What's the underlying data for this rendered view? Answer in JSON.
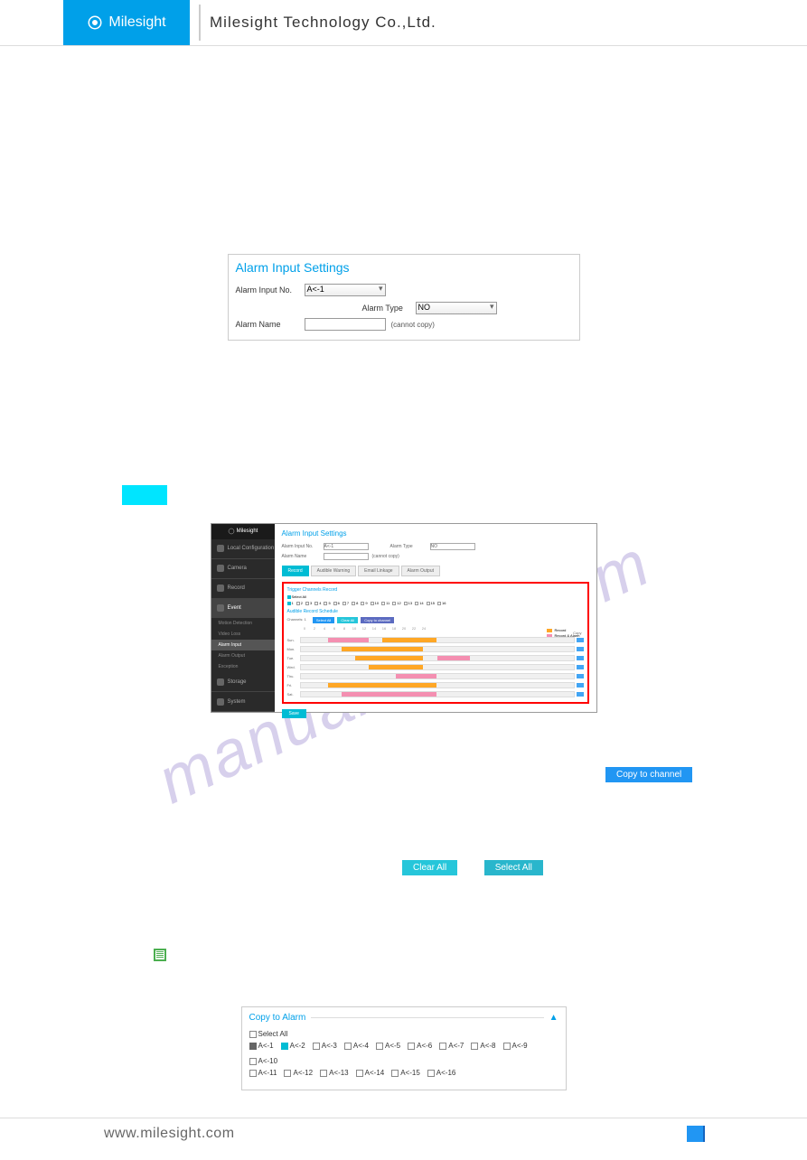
{
  "header": {
    "logo": "Milesight",
    "company": "Milesight Technology Co.,Ltd."
  },
  "ais_panel": {
    "title": "Alarm Input Settings",
    "input_no_label": "Alarm Input No.",
    "input_no_value": "A<-1",
    "type_label": "Alarm Type",
    "type_value": "NO",
    "name_label": "Alarm Name",
    "name_note": "(cannot copy)"
  },
  "screenshot": {
    "logo": "Milesight",
    "title": "Alarm Input Settings",
    "sidebar": {
      "items": [
        "Local Configuration",
        "Camera",
        "Record",
        "Event"
      ],
      "subs": [
        "Motion Detection",
        "Video Loss",
        "Alarm Input",
        "Alarm Output",
        "Exception"
      ],
      "storage": "Storage",
      "system": "System"
    },
    "fields": {
      "input_no_label": "Alarm Input No.",
      "input_no_value": "A<-1",
      "name_label": "Alarm Name",
      "name_note": "(cannot copy)",
      "type_label": "Alarm Type",
      "type_value": "NO"
    },
    "tabs": [
      "Record",
      "Audible Warning",
      "Email Linkage",
      "Alarm Output"
    ],
    "section1": "Trigger Channels Record",
    "section2": "Audible Record Schedule",
    "select_all": "Select All",
    "btns": [
      "Select All",
      "Clear All",
      "Copy to channel"
    ],
    "days": [
      "Sun.",
      "Mon.",
      "Tue.",
      "Wed.",
      "Thu.",
      "Fri.",
      "Sat."
    ],
    "copy_hdr": "Copy",
    "legend": [
      {
        "label": "Record",
        "color": "#ffa726"
      },
      {
        "label": "Record & Alarm",
        "color": "#f48fb1"
      }
    ],
    "hours": [
      "0",
      "2",
      "4",
      "6",
      "8",
      "10",
      "12",
      "14",
      "16",
      "18",
      "20",
      "22",
      "24"
    ],
    "save": "Save"
  },
  "buttons": {
    "copy_channel": "Copy to channel",
    "clear_all": "Clear All",
    "select_all": "Select All"
  },
  "copy_alarm": {
    "title": "Copy to Alarm",
    "select_all": "Select All",
    "items": [
      "A<-1",
      "A<-2",
      "A<-3",
      "A<-4",
      "A<-5",
      "A<-6",
      "A<-7",
      "A<-8",
      "A<-9",
      "A<-10",
      "A<-11",
      "A<-12",
      "A<-13",
      "A<-14",
      "A<-15",
      "A<-16"
    ]
  },
  "footer": {
    "url": "www.milesight.com"
  },
  "watermark": "manualshive.com"
}
